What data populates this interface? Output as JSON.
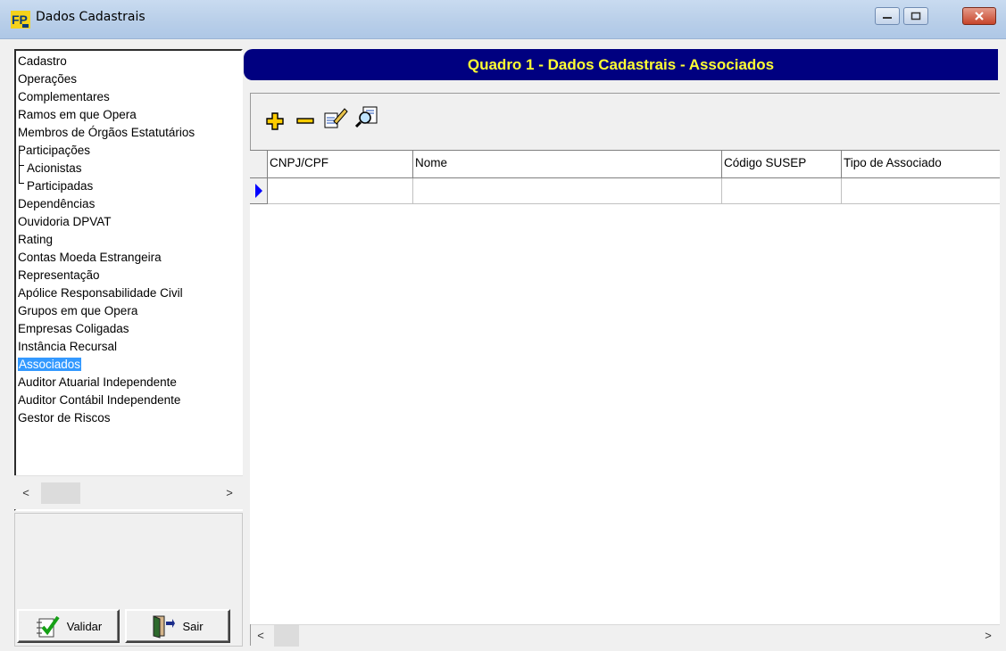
{
  "window": {
    "title": "Dados Cadastrais"
  },
  "tree": {
    "items": [
      {
        "label": "Cadastro"
      },
      {
        "label": "Operações"
      },
      {
        "label": "Complementares"
      },
      {
        "label": "Ramos em que Opera"
      },
      {
        "label": "Membros de Órgãos Estatutários"
      },
      {
        "label": "Participações"
      },
      {
        "label": "Acionistas"
      },
      {
        "label": "Participadas"
      },
      {
        "label": "Dependências"
      },
      {
        "label": "Ouvidoria DPVAT"
      },
      {
        "label": "Rating"
      },
      {
        "label": "Contas Moeda Estrangeira"
      },
      {
        "label": "Representação"
      },
      {
        "label": "Apólice Responsabilidade Civil"
      },
      {
        "label": "Grupos em que Opera"
      },
      {
        "label": "Empresas Coligadas"
      },
      {
        "label": "Instância Recursal"
      },
      {
        "label": "Associados"
      },
      {
        "label": "Auditor Atuarial Independente"
      },
      {
        "label": "Auditor Contábil Independente"
      },
      {
        "label": "Gestor de Riscos"
      }
    ],
    "selected": "Associados"
  },
  "buttons": {
    "validar": "Validar",
    "sair": "Sair"
  },
  "banner": {
    "title": "Quadro 1 - Dados Cadastrais - Associados"
  },
  "toolbar": {
    "icons": [
      "add-icon",
      "remove-icon",
      "edit-icon",
      "search-icon"
    ]
  },
  "grid": {
    "columns": [
      "CNPJ/CPF",
      "Nome",
      "Código SUSEP",
      "Tipo de Associado"
    ],
    "rows": [
      [
        "",
        "",
        "",
        ""
      ]
    ]
  },
  "colors": {
    "banner_bg": "#000080",
    "banner_text": "#ffff33",
    "selection": "#3399ff"
  }
}
